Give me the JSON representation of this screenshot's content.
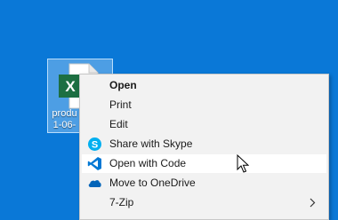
{
  "desktop": {
    "file": {
      "label_line1": "produ",
      "label_line2": "1-06-",
      "icon": "excel-file-icon",
      "badge_letter": "X",
      "colors": {
        "excel_green": "#1d6f42",
        "page": "#ffffff"
      }
    }
  },
  "context_menu": {
    "items": [
      {
        "label": "Open",
        "icon": null
      },
      {
        "label": "Print",
        "icon": null
      },
      {
        "label": "Edit",
        "icon": null
      },
      {
        "label": "Share with Skype",
        "icon": "skype-icon"
      },
      {
        "label": "Open with Code",
        "icon": "vscode-icon"
      },
      {
        "label": "Move to OneDrive",
        "icon": "onedrive-icon"
      },
      {
        "label": "7-Zip",
        "icon": "chevron-right-icon"
      }
    ],
    "default_item": "Open",
    "hovered_item": "Open with Code"
  },
  "colors": {
    "desktop_background": "#0a78d7",
    "menu_background": "#f2f2f2",
    "menu_hover": "#ffffff",
    "skype_blue": "#00aff0",
    "vscode_blue": "#0078d4",
    "onedrive_blue": "#0364b8"
  }
}
